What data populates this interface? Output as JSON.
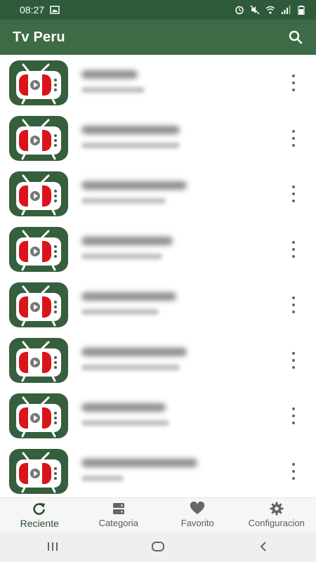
{
  "status_bar": {
    "time": "08:27"
  },
  "app_bar": {
    "title": "Tv Peru"
  },
  "channels": [
    {},
    {},
    {},
    {},
    {},
    {},
    {},
    {}
  ],
  "bottom_nav": {
    "items": [
      {
        "label": "Reciente",
        "icon": "refresh-icon",
        "active": true
      },
      {
        "label": "Categoria",
        "icon": "server-icon",
        "active": false
      },
      {
        "label": "Favorito",
        "icon": "heart-icon",
        "active": false
      },
      {
        "label": "Configuracion",
        "icon": "gear-icon",
        "active": false
      }
    ]
  },
  "colors": {
    "status_bar": "#2f5a3a",
    "app_bar": "#3d6b45",
    "tv_body": "#355f3d",
    "tv_red": "#d9141b"
  }
}
